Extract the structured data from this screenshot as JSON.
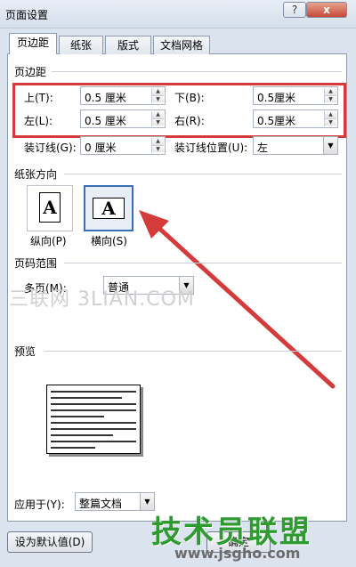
{
  "window": {
    "title": "页面设置",
    "help": "?",
    "close": "x"
  },
  "tabs": [
    {
      "label": "页边距",
      "active": true
    },
    {
      "label": "纸张",
      "active": false
    },
    {
      "label": "版式",
      "active": false
    },
    {
      "label": "文档网格",
      "active": false
    }
  ],
  "margins": {
    "group_label": "页边距",
    "top": {
      "label": "上(T):",
      "value": "0.5 厘米"
    },
    "bottom": {
      "label": "下(B):",
      "value": "0.5厘米"
    },
    "left": {
      "label": "左(L):",
      "value": "0.5 厘米"
    },
    "right": {
      "label": "右(R):",
      "value": "0.5厘米"
    },
    "gutter": {
      "label": "装订线(G):",
      "value": "0 厘米"
    },
    "gutter_pos": {
      "label": "装订线位置(U):",
      "value": "左"
    }
  },
  "orientation": {
    "group_label": "纸张方向",
    "portrait": {
      "label": "纵向(P)",
      "glyph": "A"
    },
    "landscape": {
      "label": "横向(S)",
      "glyph": "A",
      "selected": true
    }
  },
  "pages": {
    "group_label": "页码范围",
    "multi_label": "多页(M):",
    "multi_value": "普通"
  },
  "watermark": "三联网 3LIAN.COM",
  "preview": {
    "group_label": "预览"
  },
  "apply": {
    "label": "应用于(Y):",
    "value": "整篇文档"
  },
  "buttons": {
    "set_default": "设为默认值(D)",
    "ok": "确定"
  },
  "brand": {
    "main": "技术员联盟",
    "sub": "www.jsgho.com"
  },
  "colors": {
    "highlight": "#d43b3b",
    "brand": "#2f9a2f"
  }
}
